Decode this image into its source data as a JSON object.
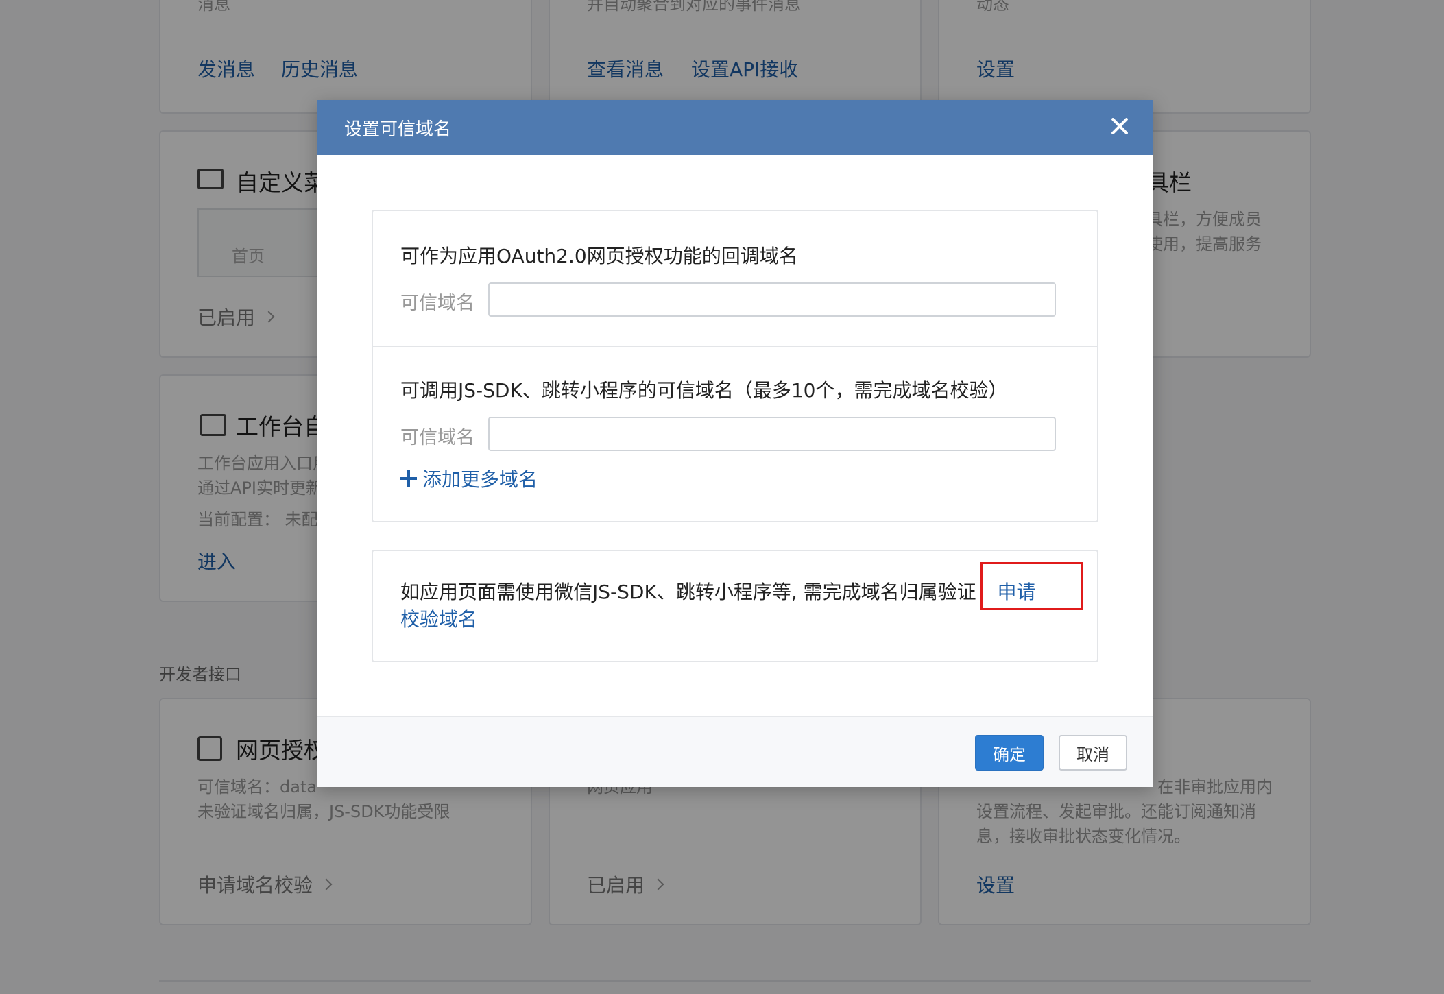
{
  "background": {
    "card1": {
      "partial_text": "消息",
      "links": [
        "发消息",
        "历史消息"
      ]
    },
    "card2": {
      "partial_text": "并自动聚合到对应的事件消息",
      "links": [
        "查看消息",
        "设置API接收"
      ]
    },
    "card3": {
      "partial_text": "动态",
      "links": [
        "设置"
      ]
    },
    "card4": {
      "title": "自定义菜",
      "tab": "首页",
      "status": "已启用"
    },
    "card5": {
      "title": "具栏",
      "desc1": "具栏，方便成员",
      "desc2": "使用，提高服务"
    },
    "card6": {
      "title": "工作台自",
      "desc1": "工作台应用入口用",
      "desc2": "通过API实时更新",
      "desc3": "当前配置： 未配",
      "link": "进入"
    },
    "section_label": "开发者接口",
    "card7": {
      "title": "网页授权",
      "desc1": "可信域名：data",
      "desc2": "未验证域名归属，JS-SDK功能受限",
      "status": "申请域名校验"
    },
    "card8": {
      "desc1": "网页应用",
      "status": "已启用"
    },
    "card9": {
      "desc1": "在非审批应用内",
      "desc2": "设置流程、发起审批。还能订阅通知消",
      "desc3": "息，接收审批状态变化情况。",
      "link": "设置"
    }
  },
  "modal": {
    "title": "设置可信域名",
    "oauth_heading": "可作为应用OAuth2.0网页授权功能的回调域名",
    "oauth_label": "可信域名",
    "oauth_value": "",
    "jssdk_heading": "可调用JS-SDK、跳转小程序的可信域名（最多10个，需完成域名校验）",
    "jssdk_label": "可信域名",
    "jssdk_value": "",
    "add_more": "添加更多域名",
    "notice_text": "如应用页面需使用微信JS-SDK、跳转小程序等, 需完成域名归属验证",
    "apply_link": "申请校验域名",
    "confirm": "确定",
    "cancel": "取消"
  },
  "colors": {
    "header": "#4f7ab0",
    "primary": "#2d7dd2",
    "link": "#1f5fa8",
    "highlight": "#e01b1b"
  }
}
